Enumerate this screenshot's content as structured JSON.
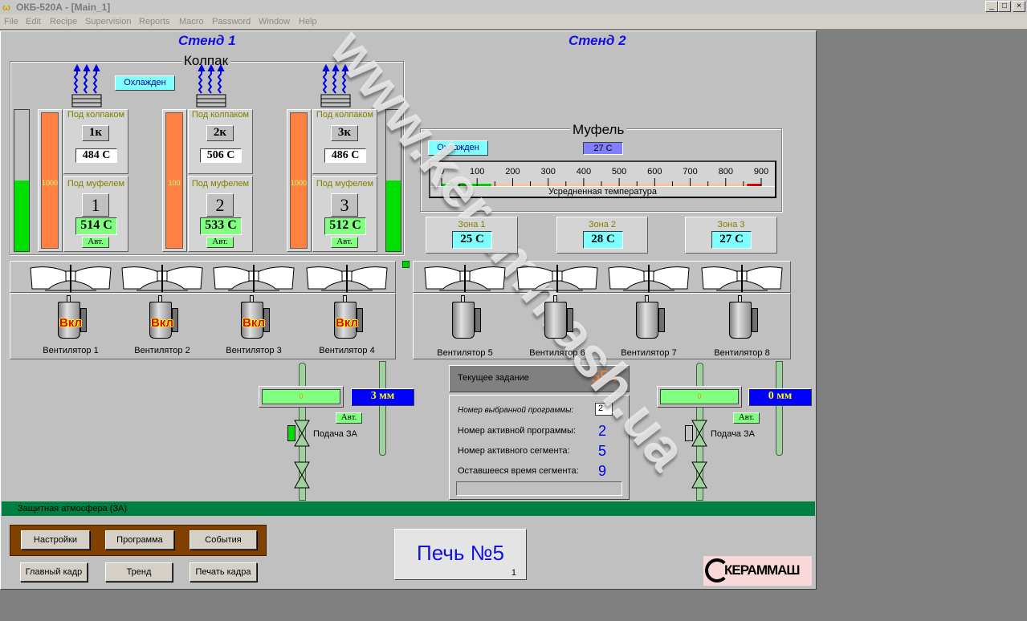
{
  "window": {
    "title": "ОКБ-520А - [Main_1]",
    "controls": [
      "_",
      "□",
      "×"
    ]
  },
  "menu": [
    "File",
    "Edit",
    "Recipe",
    "Supervision",
    "Reports",
    "Macro",
    "Password",
    "Window",
    "Help"
  ],
  "stand1": {
    "title": "Стенд 1",
    "bell_label": "Колпак",
    "status": "Охлажден",
    "heaters": [
      {
        "id": "1к",
        "under_bell_label": "Под колпаком",
        "under_bell_temp": "484 C",
        "under_muffle_label": "Под муфелем",
        "num": "1",
        "muffle_temp": "514 C",
        "mode": "Авт.",
        "power": "1000"
      },
      {
        "id": "2к",
        "under_bell_label": "Под колпаком",
        "under_bell_temp": "506 C",
        "under_muffle_label": "Под муфелем",
        "num": "2",
        "muffle_temp": "533 C",
        "mode": "Авт.",
        "power": "100"
      },
      {
        "id": "3к",
        "under_bell_label": "Под колпаком",
        "under_bell_temp": "486 C",
        "under_muffle_label": "Под муфелем",
        "num": "3",
        "muffle_temp": "512 C",
        "mode": "Авт.",
        "power": "1000"
      }
    ],
    "level_left_pct": 50,
    "level_right_pct": 50,
    "fans": [
      {
        "label": "Вентилятор 1",
        "state": "Вкл"
      },
      {
        "label": "Вентилятор 2",
        "state": "Вкл"
      },
      {
        "label": "Вентилятор 3",
        "state": "Вкл"
      },
      {
        "label": "Вентилятор 4",
        "state": "Вкл"
      }
    ],
    "gas": {
      "flow": "0",
      "position": "3 мм",
      "mode": "Авт.",
      "valve_label": "Подача ЗА",
      "valve_open": true
    }
  },
  "stand2": {
    "title": "Стенд 2",
    "muffle_label": "Муфель",
    "status": "Охлажден",
    "avg_temp": "27 C",
    "scale": {
      "ticks": [
        "0",
        "100",
        "200",
        "300",
        "400",
        "500",
        "600",
        "700",
        "800",
        "900"
      ],
      "caption": "Усредненная температура",
      "value": 27,
      "green_max": 140,
      "red_min": 860,
      "max": 900
    },
    "zones": [
      {
        "label": "Зона 1",
        "temp": "25 C"
      },
      {
        "label": "Зона 2",
        "temp": "28 C"
      },
      {
        "label": "Зона 3",
        "temp": "27 C"
      }
    ],
    "fans": [
      {
        "label": "Вентилятор 5"
      },
      {
        "label": "Вентилятор 6"
      },
      {
        "label": "Вентилятор 7"
      },
      {
        "label": "Вентилятор 8"
      }
    ],
    "gas": {
      "flow": "0",
      "position": "0 мм",
      "mode": "Авт.",
      "valve_label": "Подача ЗА",
      "valve_open": false
    }
  },
  "program": {
    "current_task_label": "Текущее задание",
    "current_task": "554",
    "selected_label": "Номер выбранной программы:",
    "selected": "2",
    "active_label": "Номер активной программы:",
    "active": "2",
    "segment_label": "Номер активного сегмента:",
    "segment": "5",
    "remaining_label": "Оставшееся время сегмента:",
    "remaining": "9"
  },
  "status_bar": "Защитная атмосфера (ЗА)",
  "buttons": {
    "settings": "Настройки",
    "program": "Программа",
    "events": "События",
    "main": "Главный кадр",
    "trend": "Тренд",
    "print": "Печать кадра"
  },
  "furnace": {
    "title": "Печь №5",
    "sub": "1"
  },
  "logo": "КЕРАММАШ",
  "watermark": "www.kerammash.ua",
  "colors": {
    "accent": "#1010e0",
    "ok": "#80ff80",
    "cool": "#80ffff",
    "heater": "#ff8040",
    "status_bar": "#008040"
  }
}
